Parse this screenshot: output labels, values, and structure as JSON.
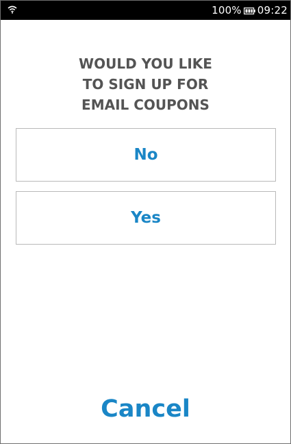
{
  "status_bar": {
    "icons": [
      "wifi-icon",
      "battery-icon"
    ],
    "battery_level": "100%",
    "time": "09:22"
  },
  "prompt": {
    "lines": [
      "WOULD YOU LIKE",
      "TO SIGN UP FOR",
      "EMAIL COUPONS"
    ]
  },
  "options": {
    "no_label": "No",
    "yes_label": "Yes"
  },
  "footer": {
    "cancel_label": "Cancel"
  },
  "colors": {
    "accent": "#1a86c6",
    "prompt_text": "#545454",
    "button_border": "#b9b9b9",
    "status_bar": "#000000"
  }
}
